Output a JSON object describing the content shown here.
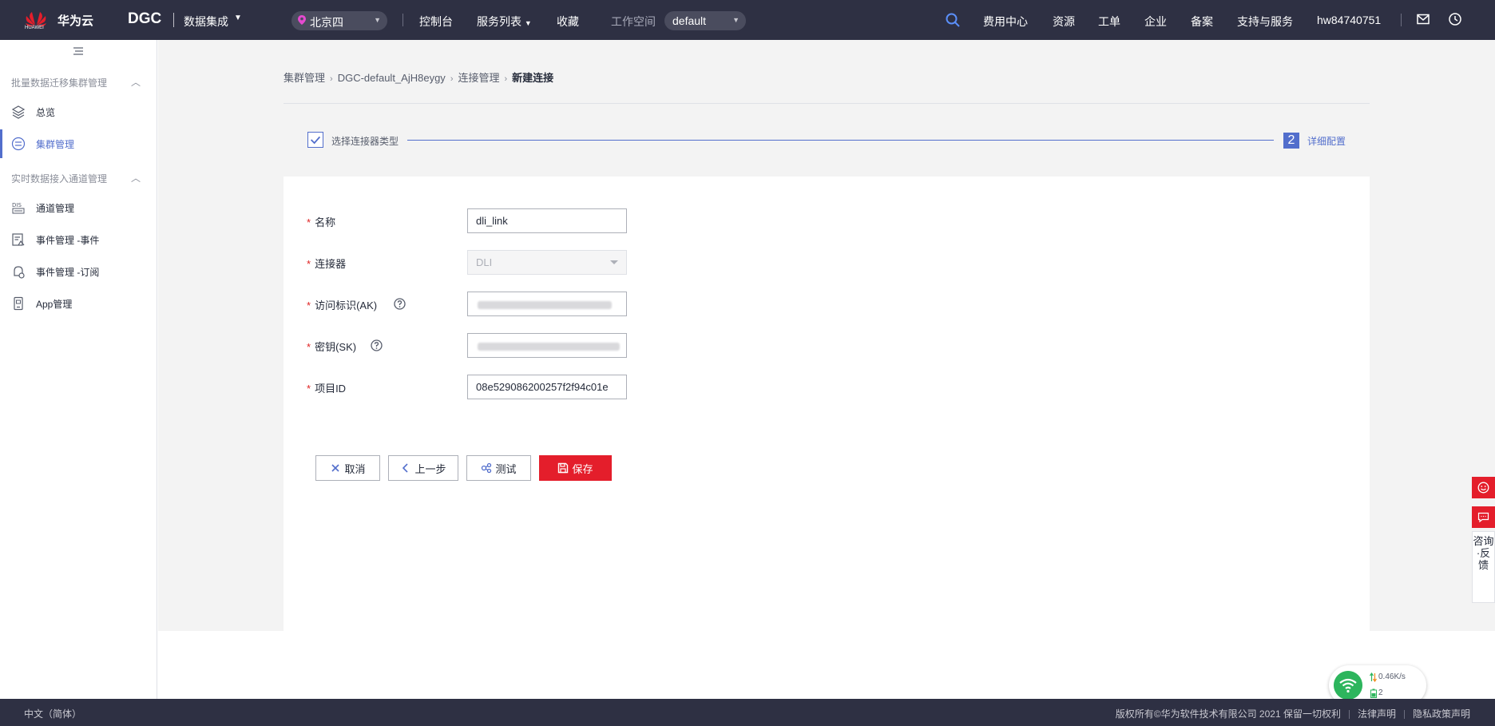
{
  "topbar": {
    "brand": "华为云",
    "brand_sub": "HUAWEI",
    "service": "DGC",
    "module": "数据集成",
    "region": "北京四",
    "nav": {
      "console": "控制台",
      "services": "服务列表",
      "favorites": "收藏"
    },
    "workspace_label": "工作空间",
    "workspace_value": "default",
    "right_nav": {
      "billing": "费用中心",
      "resources": "资源",
      "tickets": "工单",
      "enterprise": "企业",
      "icp": "备案",
      "support": "支持与服务",
      "username": "hw84740751"
    }
  },
  "sidebar": {
    "group1": "批量数据迁移集群管理",
    "group2": "实时数据接入通道管理",
    "items": [
      {
        "label": "总览"
      },
      {
        "label": "集群管理"
      },
      {
        "label": "通道管理"
      },
      {
        "label": "事件管理 -事件"
      },
      {
        "label": "事件管理 -订阅"
      },
      {
        "label": "App管理"
      }
    ]
  },
  "breadcrumb": {
    "items": [
      "集群管理",
      "DGC-default_AjH8eygy",
      "连接管理"
    ],
    "current": "新建连接"
  },
  "steps": {
    "step1": "选择连接器类型",
    "step2_num": "2",
    "step2": "详细配置"
  },
  "form": {
    "req_mark": "*",
    "name_label": "名称",
    "name_value": "dli_link",
    "connector_label": "连接器",
    "connector_value": "DLI",
    "ak_label": "访问标识(AK)",
    "sk_label": "密钥(SK)",
    "project_label": "项目ID",
    "project_value": "08e529086200257f2f94c01e"
  },
  "buttons": {
    "cancel": "取消",
    "prev": "上一步",
    "test": "测试",
    "save": "保存"
  },
  "float": {
    "feedback": "咨询·反馈"
  },
  "network": {
    "speed": "0.46K/s",
    "count": "2"
  },
  "footer": {
    "lang": "中文（简体）",
    "copyright": "版权所有©华为软件技术有限公司 2021 保留一切权利",
    "legal": "法律声明",
    "privacy": "隐私政策声明"
  },
  "colors": {
    "topbar": "#2e3043",
    "accent": "#526ecc",
    "primary_button": "#e41e2b"
  }
}
